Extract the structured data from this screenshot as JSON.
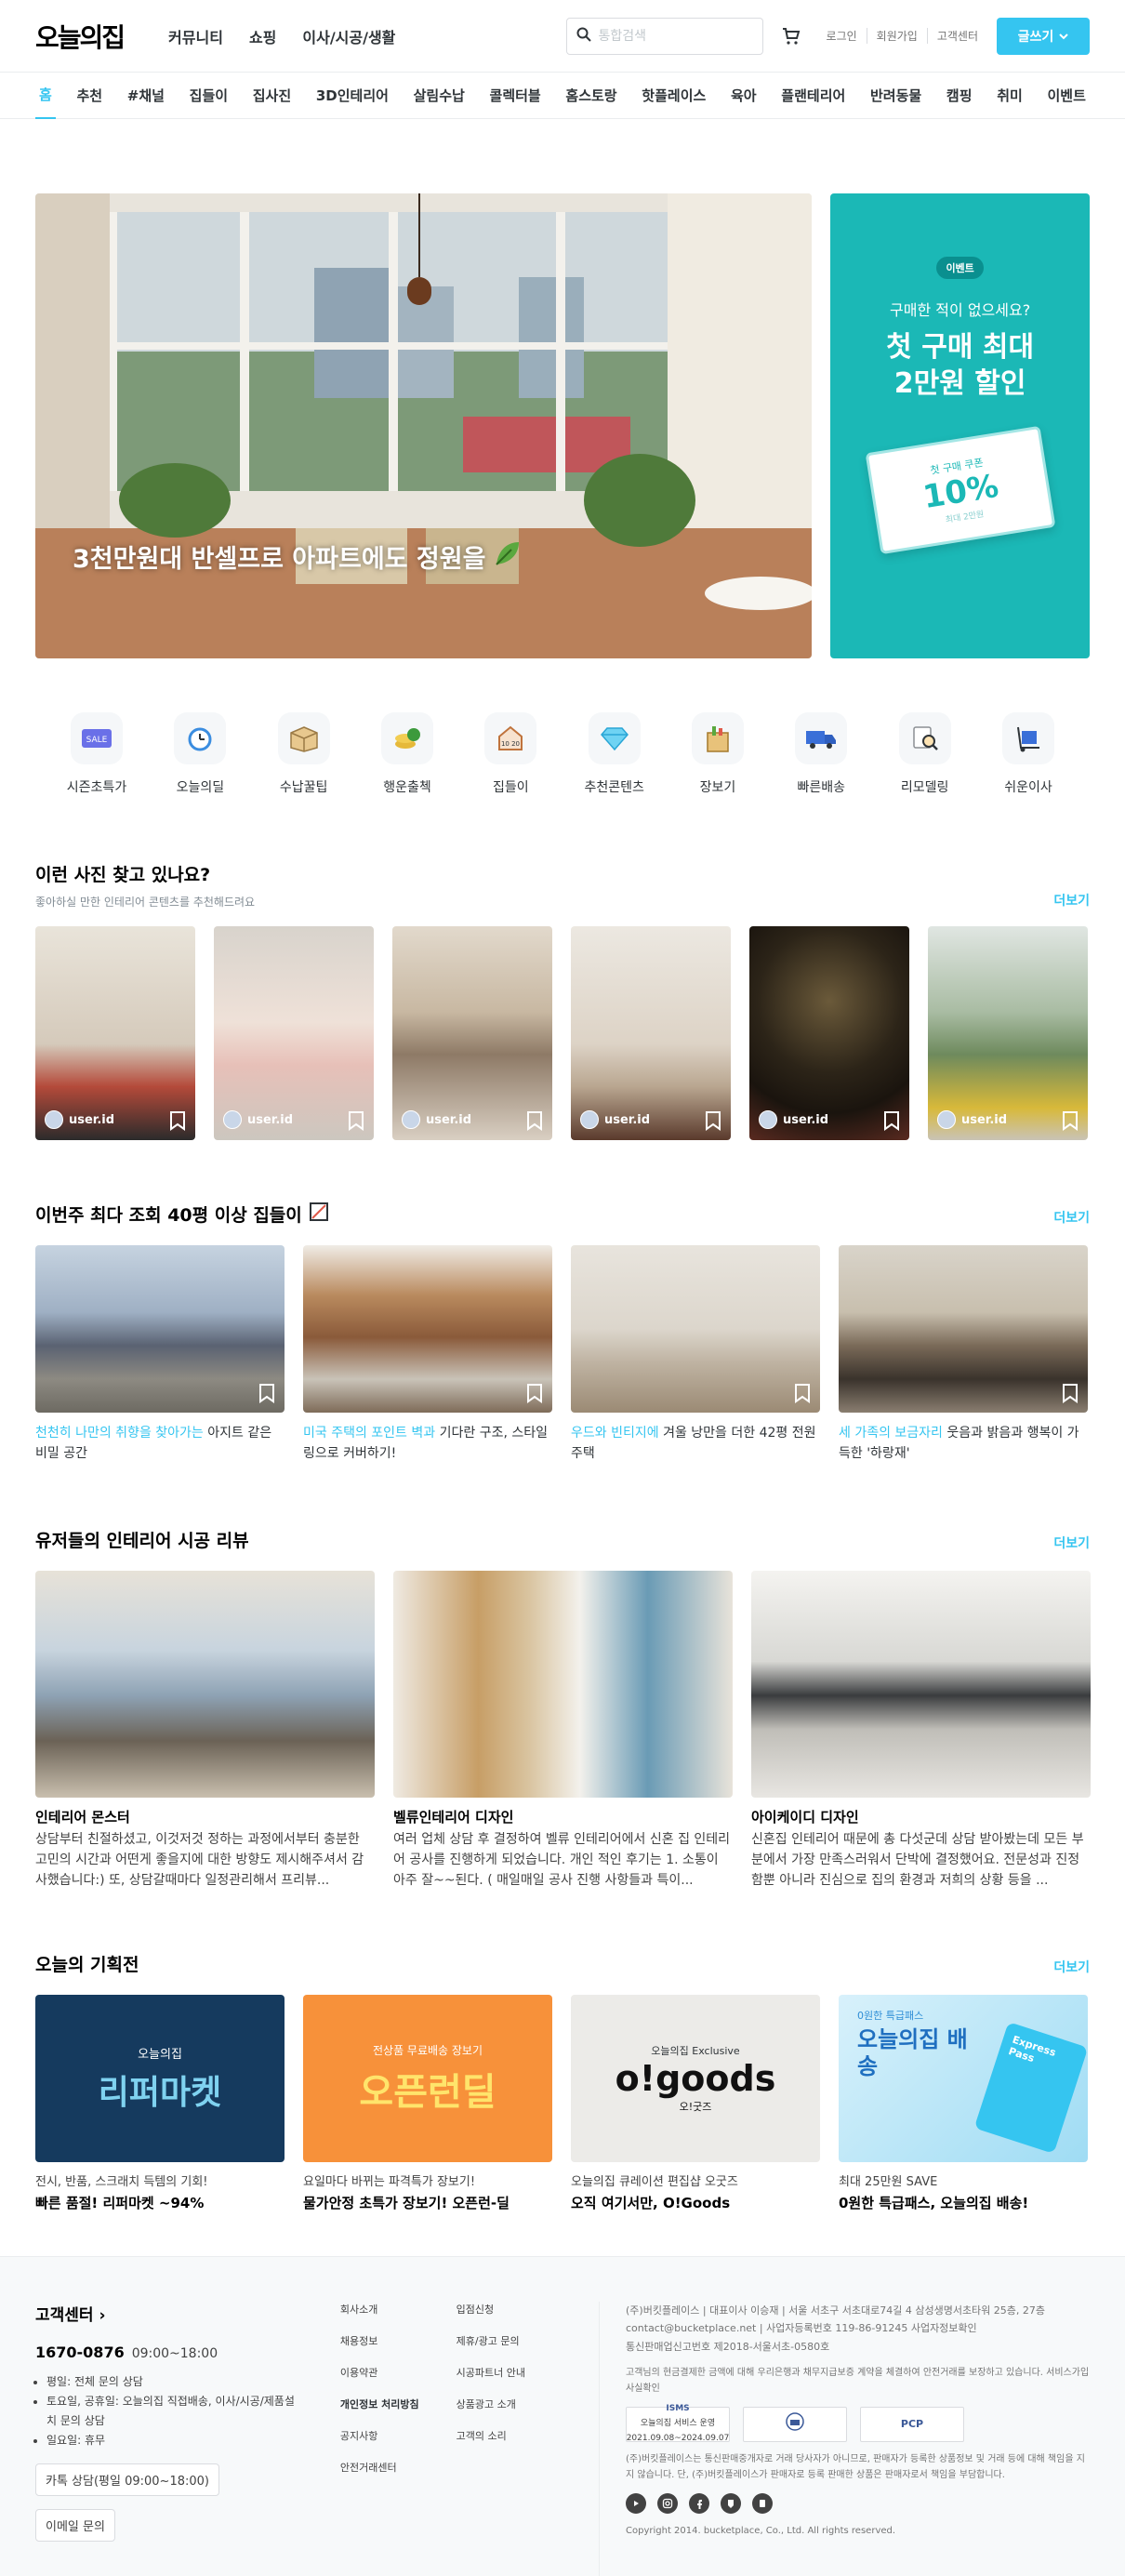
{
  "header": {
    "logo": "오늘의집",
    "nav": [
      "커뮤니티",
      "쇼핑",
      "이사/시공/생활"
    ],
    "search_placeholder": "통합검색",
    "user_links": [
      "로그인",
      "회원가입",
      "고객센터"
    ],
    "write_label": "글쓰기"
  },
  "categories": [
    "홈",
    "추천",
    "#채널",
    "집들이",
    "집사진",
    "3D인테리어",
    "살림수납",
    "콜렉터블",
    "홈스토랑",
    "핫플레이스",
    "육아",
    "플랜테리어",
    "반려동물",
    "캠핑",
    "취미",
    "이벤트"
  ],
  "hero": {
    "caption": "3천만원대 반셀프로 아파트에도 정원을",
    "side": {
      "badge": "이벤트",
      "sub": "구매한 적이 없으세요?",
      "title_line1": "첫 구매 최대",
      "title_line2": "2만원 할인",
      "coupon_label": "첫 구매 쿠폰",
      "coupon_value": "10%",
      "coupon_max": "최대 2만원"
    }
  },
  "quick_menu": [
    {
      "label": "시즌초특가",
      "icon": "sale-tag-icon"
    },
    {
      "label": "오늘의딜",
      "icon": "alarm-clock-icon"
    },
    {
      "label": "수납꿀팁",
      "icon": "box-icon"
    },
    {
      "label": "행운출첵",
      "icon": "coin-icon"
    },
    {
      "label": "집들이",
      "icon": "house-icon"
    },
    {
      "label": "추천콘텐츠",
      "icon": "diamond-icon"
    },
    {
      "label": "장보기",
      "icon": "grocery-bag-icon"
    },
    {
      "label": "빠른배송",
      "icon": "truck-icon"
    },
    {
      "label": "리모델링",
      "icon": "magnifier-icon"
    },
    {
      "label": "쉬운이사",
      "icon": "hand-truck-icon"
    }
  ],
  "photos_section": {
    "title": "이런 사진 찾고 있나요?",
    "subtitle": "좋아하실 만한 인테리어 콘텐츠를 추천해드려요",
    "more": "더보기",
    "cards": [
      {
        "user": "user.id"
      },
      {
        "user": "user.id"
      },
      {
        "user": "user.id"
      },
      {
        "user": "user.id"
      },
      {
        "user": "user.id"
      },
      {
        "user": "user.id"
      }
    ]
  },
  "houses_section": {
    "title": "이번주 최다 조회 40평 이상 집들이",
    "more": "더보기",
    "cards": [
      {
        "highlight": "천천히 나만의 취향을 찾아가는",
        "rest": " 아지트 같은 비밀 공간"
      },
      {
        "highlight": "미국 주택의 포인트 벽과",
        "rest": " 기다란 구조, 스타일링으로 커버하기!"
      },
      {
        "highlight": "우드와 빈티지에",
        "rest": " 겨울 낭만을 더한 42평 전원주택"
      },
      {
        "highlight": "세 가족의 보금자리",
        "rest": " 웃음과 밝음과 행복이 가득한 '하랑재'"
      }
    ]
  },
  "reviews_section": {
    "title": "유저들의 인테리어 시공 리뷰",
    "more": "더보기",
    "cards": [
      {
        "name": "인테리어 몬스터",
        "text": "상담부터 친절하셨고, 이것저것 정하는 과정에서부터 충분한 고민의 시간과 어떤게 좋을지에 대한 방향도 제시해주셔서 감사했습니다:) 또, 상담갈때마다 일정관리해서 프리뷰..."
      },
      {
        "name": "벨류인테리어 디자인",
        "text": "여러 업체 상담 후 결정하여 벨류 인테리어에서 신혼 집 인테리어 공사를 진행하게 되었습니다. 개인 적인 후기는 1. 소통이 아주 잘~~된다. ( 매일매일 공사 진행 사항들과 특이..."
      },
      {
        "name": "아이케이디 디자인",
        "text": "신혼집 인테리어 때문에 총 다섯군데 상담 받아봤는데 모든 부분에서 가장 만족스러워서 단박에 결정했어요. 전문성과 진정함뿐 아니라 진심으로 집의 환경과 저희의 상황 등을 ..."
      }
    ]
  },
  "plans_section": {
    "title": "오늘의 기획전",
    "more": "더보기",
    "cards": [
      {
        "sub": "전시, 반품, 스크래치 득템의 기회!",
        "title": "빠른 품절! 리퍼마켓 ~94%",
        "banner_top": "오늘의집",
        "banner_main": "리퍼마켓"
      },
      {
        "sub": "요일마다 바뀌는 파격특가 장보기!",
        "title": "물가안정 초특가 장보기! 오픈런-딜",
        "banner_top": "전상품 무료배송 장보기",
        "banner_main": "오픈런딜"
      },
      {
        "sub": "오늘의집 큐레이션 편집샵 오굿즈",
        "title": "오직 여기서만, O!Goods",
        "banner_top": "오늘의집 Exclusive",
        "banner_main": "o!goods",
        "banner_sub": "오!굿즈"
      },
      {
        "sub": "최대 25만원 SAVE",
        "title": "0원한 특급패스, 오늘의집 배송!",
        "banner_top": "0원한 특급패스",
        "banner_main": "오늘의집 배송",
        "card_label": "Express Pass"
      }
    ]
  },
  "footer": {
    "cs_title": "고객센터",
    "phone": "1670-0876",
    "hours": "09:00~18:00",
    "hour_notes": [
      "평일: 전체 문의 상담",
      "토요일, 공휴일: 오늘의집 직접배송, 이사/시공/제품설치 문의 상담",
      "일요일: 휴무"
    ],
    "btn_chat": "카톡 상담(평일 09:00~18:00)",
    "btn_email": "이메일 문의",
    "links_col1": [
      "회사소개",
      "채용정보",
      "이용약관",
      "개인정보 처리방침",
      "공지사항",
      "안전거래센터"
    ],
    "links_col2": [
      "입점신청",
      "제휴/광고 문의",
      "시공파트너 안내",
      "상품광고 소개",
      "고객의 소리"
    ],
    "company_line1": "(주)버킷플레이스 | 대표이사 이승재 | 서울 서초구 서초대로74길 4 삼성생명서초타워 25층, 27층",
    "company_line2": "contact@bucketplace.net | 사업자등록번호 119-86-91245 사업자정보확인",
    "company_line3": "통신판매업신고번호 제2018-서울서초-0580호",
    "notice1": "고객님의 현금결제한 금액에 대해 우리은행과 채무지급보증 계약을 체결하여 안전거래를 보장하고 있습니다. 서비스가입사실확인",
    "cert1": "ISMS",
    "cert1_note": "오늘의집 서비스 운영",
    "cert1_date": "2021.09.08~2024.09.07",
    "cert3": "PCP",
    "notice2": "(주)버킷플레이스는 통신판매중개자로 거래 당사자가 아니므로, 판매자가 등록한 상품정보 및 거래 등에 대해 책임을 지지 않습니다. 단, (주)버킷플레이스가 판매자로 등록 판매한 상품은 판매자로서 책임을 부담합니다.",
    "copyright": "Copyright 2014. bucketplace, Co., Ltd. All rights reserved.",
    "social": [
      "youtube-icon",
      "instagram-icon",
      "facebook-icon",
      "blog-icon",
      "post-icon"
    ]
  },
  "colors": {
    "accent": "#35c5f0",
    "side_banner": "#1bb8b6"
  }
}
